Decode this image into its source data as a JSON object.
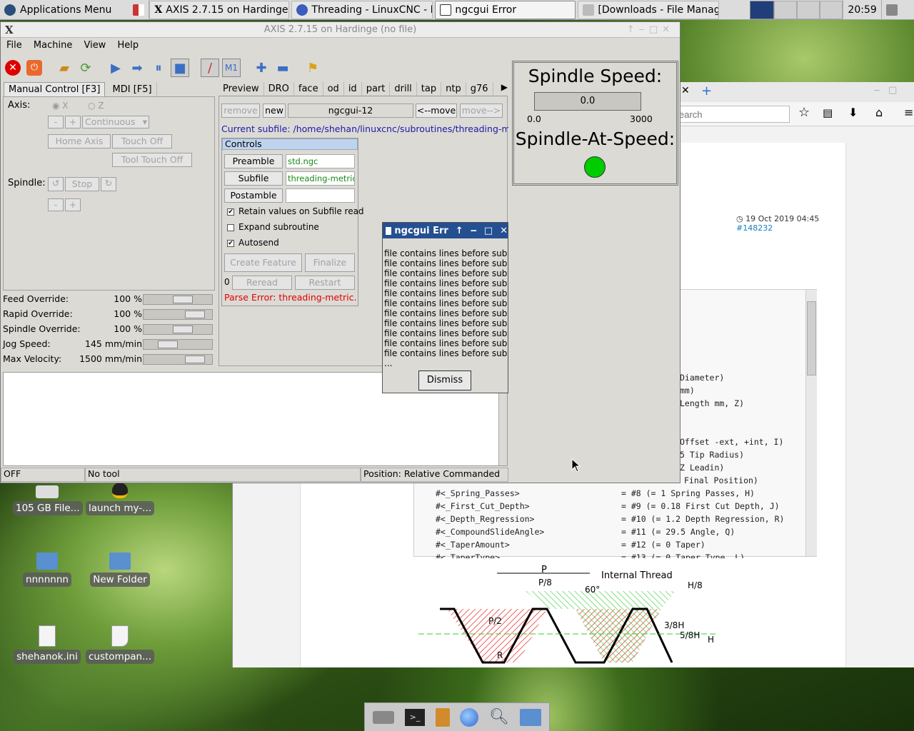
{
  "taskbar": {
    "apps_menu": "Applications Menu",
    "clock": "20:59",
    "tasks": [
      {
        "label": "AXIS 2.7.15 on Hardinge..."
      },
      {
        "label": "Threading - LinuxCNC - I..."
      },
      {
        "label": "ngcgui Error"
      },
      {
        "label": "[Downloads - File Manag..."
      }
    ]
  },
  "browser": {
    "search_placeholder": "earch",
    "post_date": "19 Oct 2019 04:45",
    "post_id": "#148232",
    "code_right": [
      "Diameter)",
      "mm)",
      "Length mm, Z)",
      "Offset -ext, +int, I)",
      "5 Tip Radius)",
      "Z Leadin)",
      "Final Position)"
    ],
    "code_rows": [
      {
        "k": "#<_Spring_Passes>",
        "v": "= #8 (= 1 Spring Passes, H)"
      },
      {
        "k": "#<_First_Cut_Depth>",
        "v": "= #9 (= 0.18 First Cut Depth, J)"
      },
      {
        "k": "#<_Depth_Regression>",
        "v": "= #10 (= 1.2 Depth Regression, R)"
      },
      {
        "k": "#<_CompoundSlideAngle>",
        "v": "= #11 (= 29.5 Angle, Q)"
      },
      {
        "k": "#<_TaperAmount>",
        "v": "= #12 (= 0 Taper)"
      },
      {
        "k": "#<_TaperType>",
        "v": "= #13 (= 0 Taper Type, L)"
      }
    ],
    "diagram": {
      "title": "Internal Thread",
      "p": "P",
      "p8": "P/8",
      "angle": "60°",
      "p2": "P/2",
      "h8": "H/8",
      "h38": "3/8H",
      "h58": "5/8H",
      "h": "H",
      "r": "R"
    }
  },
  "axis": {
    "title": "AXIS 2.7.15 on Hardinge (no file)",
    "menu": [
      "File",
      "Machine",
      "View",
      "Help"
    ],
    "tabs_left": [
      "Manual Control [F3]",
      "MDI [F5]"
    ],
    "axis_label": "Axis:",
    "axis_x": "X",
    "axis_z": "Z",
    "minus": "-",
    "plus": "+",
    "jog_mode": "Continuous",
    "home_axis": "Home Axis",
    "touch_off": "Touch Off",
    "tool_touch_off": "Tool Touch Off",
    "spindle_label": "Spindle:",
    "stop": "Stop",
    "overrides": [
      {
        "label": "Feed Override:",
        "value": "100 %",
        "level": 0.6
      },
      {
        "label": "Rapid Override:",
        "value": "100 %",
        "level": 0.85
      },
      {
        "label": "Spindle Override:",
        "value": "100 %",
        "level": 0.6
      },
      {
        "label": "Jog Speed:",
        "value": "145 mm/min",
        "level": 0.3
      },
      {
        "label": "Max Velocity:",
        "value": "1500 mm/min",
        "level": 0.85
      }
    ],
    "tabs_right": [
      "Preview",
      "DRO",
      "face",
      "od",
      "id",
      "part",
      "drill",
      "tap",
      "ntp",
      "g76"
    ],
    "remove": "remove",
    "new": "new",
    "page": "ngcgui-12",
    "move_left": "<--move",
    "move_right": "move-->",
    "subfile_path": "Current subfile: /home/shehan/linuxcnc/subroutines/threading-me",
    "controls_title": "Controls",
    "preamble": "Preamble",
    "preamble_val": "std.ngc",
    "subfile": "Subfile",
    "subfile_val": "threading-metric.",
    "postamble": "Postamble",
    "postamble_val": "",
    "retain": "Retain values on Subfile read",
    "expand": "Expand subroutine",
    "autosend": "Autosend",
    "create_feature": "Create Feature",
    "finalize": "Finalize",
    "counter": "0",
    "reread": "Reread",
    "restart": "Restart",
    "parse_error": "Parse Error: threading-metric.n",
    "spindle_speed": "Spindle Speed:",
    "speed_value": "0.0",
    "scale_min": "0.0",
    "scale_max": "3000",
    "at_speed": "Spindle-At-Speed:",
    "status_state": "OFF",
    "status_tool": "No tool",
    "status_position": "Position: Relative Commanded"
  },
  "dialog": {
    "title": "ngcgui Err",
    "line": "file contains lines before sub",
    "line_count": 11,
    "ellipsis": "...",
    "dismiss": "Dismiss"
  },
  "desktop": [
    {
      "label": "105 GB File..."
    },
    {
      "label": "launch my-..."
    },
    {
      "label": "nnnnnnn"
    },
    {
      "label": "New Folder"
    },
    {
      "label": "shehanok.ini"
    },
    {
      "label": "custompan..."
    }
  ],
  "colors": {
    "title_blue": "#244f91",
    "green_led": "#00cc00",
    "error_red": "#e00000",
    "link_blue": "#1a1aa6"
  }
}
